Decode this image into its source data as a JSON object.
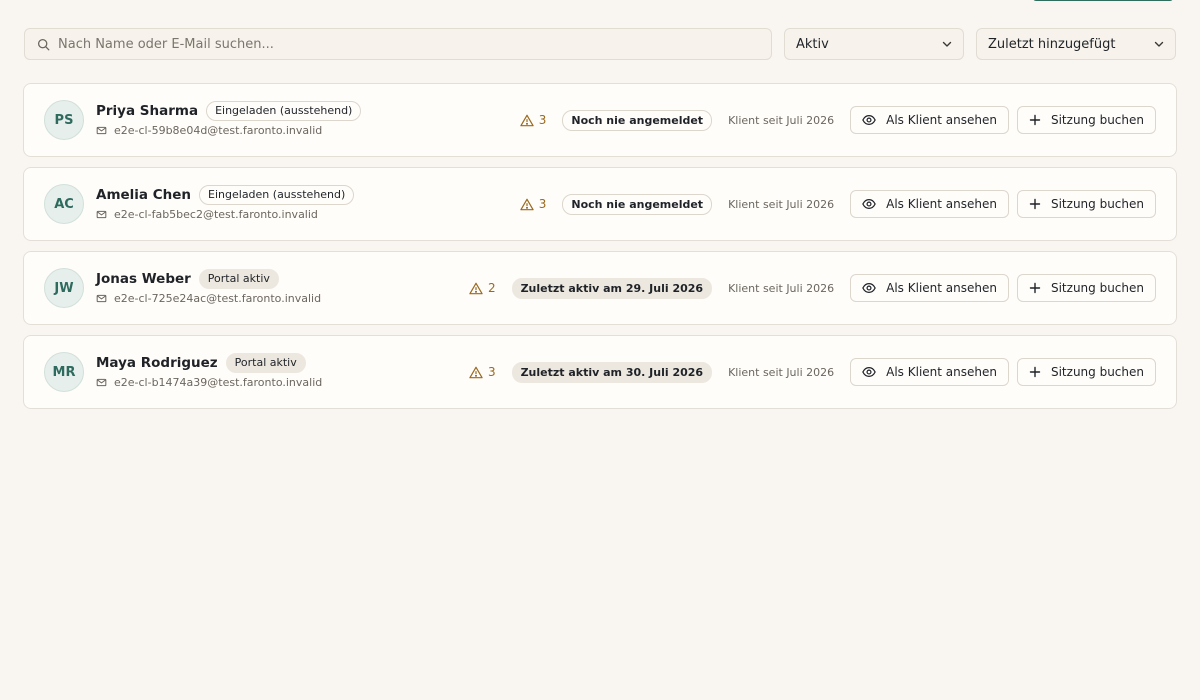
{
  "search": {
    "placeholder": "Nach Name oder E-Mail suchen...",
    "value": ""
  },
  "filters": {
    "status": "Aktiv",
    "sort": "Zuletzt hinzugefügt"
  },
  "colors": {
    "accent": "#2f6e5c",
    "warning": "#9a6a1f",
    "background": "#f9f6f1"
  },
  "actions": {
    "view_label": "Als Klient ansehen",
    "book_label": "Sitzung buchen"
  },
  "clients": [
    {
      "initials": "PS",
      "name": "Priya Sharma",
      "portal_status": "Eingeladen (ausstehend)",
      "email": "e2e-cl-59b8e04d@test.faronto.invalid",
      "warnings": "3",
      "activity": "Noch nie angemeldet",
      "since": "Klient seit Juli 2026"
    },
    {
      "initials": "AC",
      "name": "Amelia Chen",
      "portal_status": "Eingeladen (ausstehend)",
      "email": "e2e-cl-fab5bec2@test.faronto.invalid",
      "warnings": "3",
      "activity": "Noch nie angemeldet",
      "since": "Klient seit Juli 2026"
    },
    {
      "initials": "JW",
      "name": "Jonas Weber",
      "portal_status": "Portal aktiv",
      "email": "e2e-cl-725e24ac@test.faronto.invalid",
      "warnings": "2",
      "activity": "Zuletzt aktiv am 29. Juli 2026",
      "since": "Klient seit Juli 2026"
    },
    {
      "initials": "MR",
      "name": "Maya Rodriguez",
      "portal_status": "Portal aktiv",
      "email": "e2e-cl-b1474a39@test.faronto.invalid",
      "warnings": "3",
      "activity": "Zuletzt aktiv am 30. Juli 2026",
      "since": "Klient seit Juli 2026"
    }
  ]
}
